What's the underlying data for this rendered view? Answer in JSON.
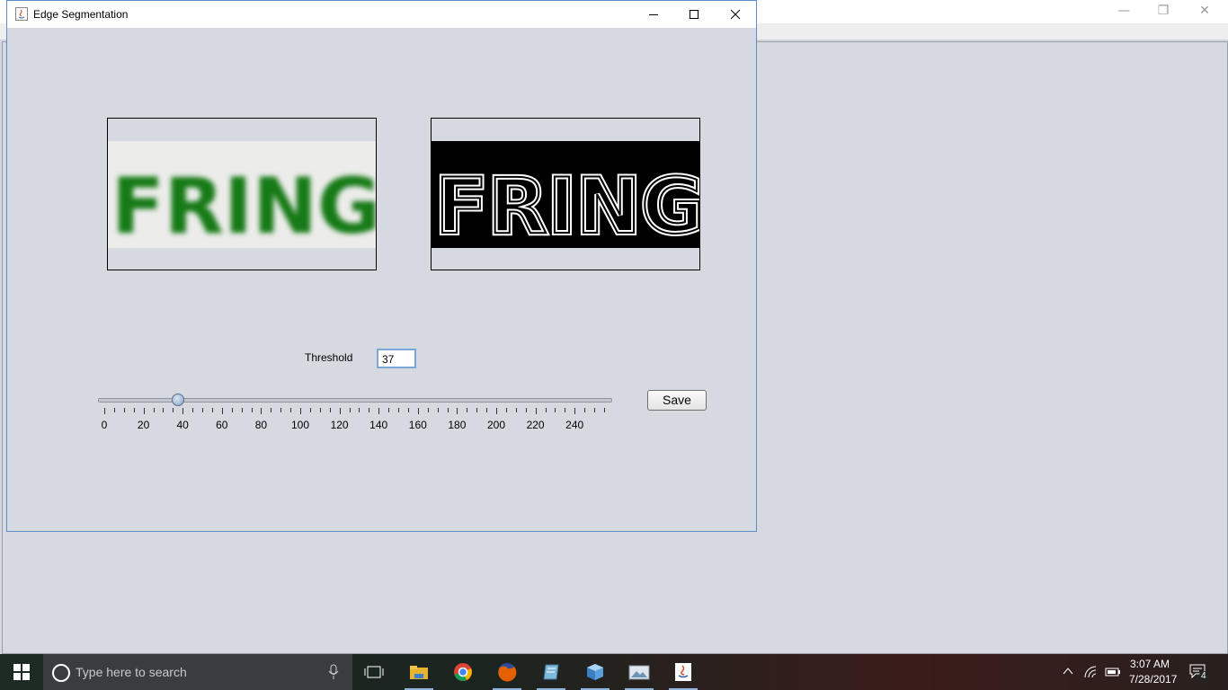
{
  "window": {
    "title": "Edge Segmentation"
  },
  "controls": {
    "threshold_label": "Threshold",
    "threshold_value": "37",
    "save_label": "Save"
  },
  "slider": {
    "min": 0,
    "max": 255,
    "value": 37,
    "tick_labels": [
      "0",
      "20",
      "40",
      "60",
      "80",
      "100",
      "120",
      "140",
      "160",
      "180",
      "200",
      "220",
      "240"
    ]
  },
  "images": {
    "original_text": "FRING",
    "edges_text": "FRING",
    "colors": {
      "original_fg": "#137a13",
      "original_bg": "#ececea",
      "edges_fg": "#ffffff",
      "edges_bg": "#000000"
    }
  },
  "taskbar": {
    "search_placeholder": "Type here to search",
    "clock_time": "3:07 AM",
    "clock_date": "7/28/2017",
    "notification_count": "4",
    "apps": [
      "task-view-icon",
      "file-explorer-icon",
      "chrome-icon",
      "firefox-icon",
      "notepad-icon",
      "cube-app-icon",
      "image-viewer-icon",
      "java-icon"
    ]
  }
}
